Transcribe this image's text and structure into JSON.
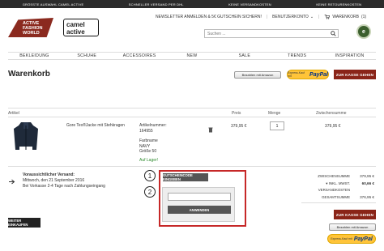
{
  "topbar": [
    "GRÖSSTE AUSWAHL CAMEL ACTIVE",
    "SCHNELLER VERSAND PER DHL",
    "KEINE VERSANDKOSTEN",
    "KEINE RETOURENKOSTEN"
  ],
  "logos": {
    "afw": [
      "ACTIVE",
      "FASHION",
      "WORLD"
    ],
    "ca": [
      "camel",
      "active"
    ]
  },
  "header": {
    "newsletter": "NEWSLETTER ANMELDEN & 5€ GUTSCHEIN SICHERN!",
    "account": "BENUTZERKONTO",
    "cart_label": "WARENKORB",
    "cart_count": "(1)",
    "search_placeholder": "Suchen ...",
    "trust_badge": "e"
  },
  "nav": [
    "BEKLEIDUNG",
    "SCHUHE",
    "ACCESSOIRES",
    "NEW",
    "SALE",
    "TRENDS",
    "INSPIRATION"
  ],
  "page_title": "Warenkorb",
  "payments": {
    "amazon": "Bezahlen mit Amazon",
    "paypal_small": "Express-Kauf mit",
    "paypal": "PayPal"
  },
  "checkout_btn": "ZUR KASSE GEHEN",
  "table_headers": {
    "article": "Artikel",
    "price": "Preis",
    "qty": "Menge",
    "subtotal": "Zwischensumme"
  },
  "item": {
    "name": "Gore Tex®Jacke mit Stehkragen",
    "sku_label": "Artikelnummer:",
    "sku": "164955",
    "color_label": "Farbname",
    "color": "NAVY",
    "size": "Größe 50",
    "stock": "Auf Lager!",
    "price": "379,95 €",
    "qty": "1",
    "subtotal": "379,95 €"
  },
  "shipping": {
    "title": "Voraussichtlicher Versand:",
    "date": "Mittwoch, den 21 September 2016",
    "note": "Bei Vorkasse 2-4 Tage nach Zahlungseingang"
  },
  "coupon": {
    "btn": "GUTSCHEINCODE EINGEBEN",
    "apply": "ANWENDEN",
    "step1": "1",
    "step2": "2"
  },
  "summary": {
    "rows": [
      {
        "label": "ZWISCHENSUMME",
        "value": "379,95 €"
      },
      {
        "label": "INKL. MWST.",
        "value": "60,66 €"
      },
      {
        "label": "VERSANDKOSTEN",
        "value": ""
      },
      {
        "label": "GESAMTSUMME",
        "value": "376,95 €"
      }
    ]
  },
  "continue_btn": "WEITER EINKAUFEN"
}
